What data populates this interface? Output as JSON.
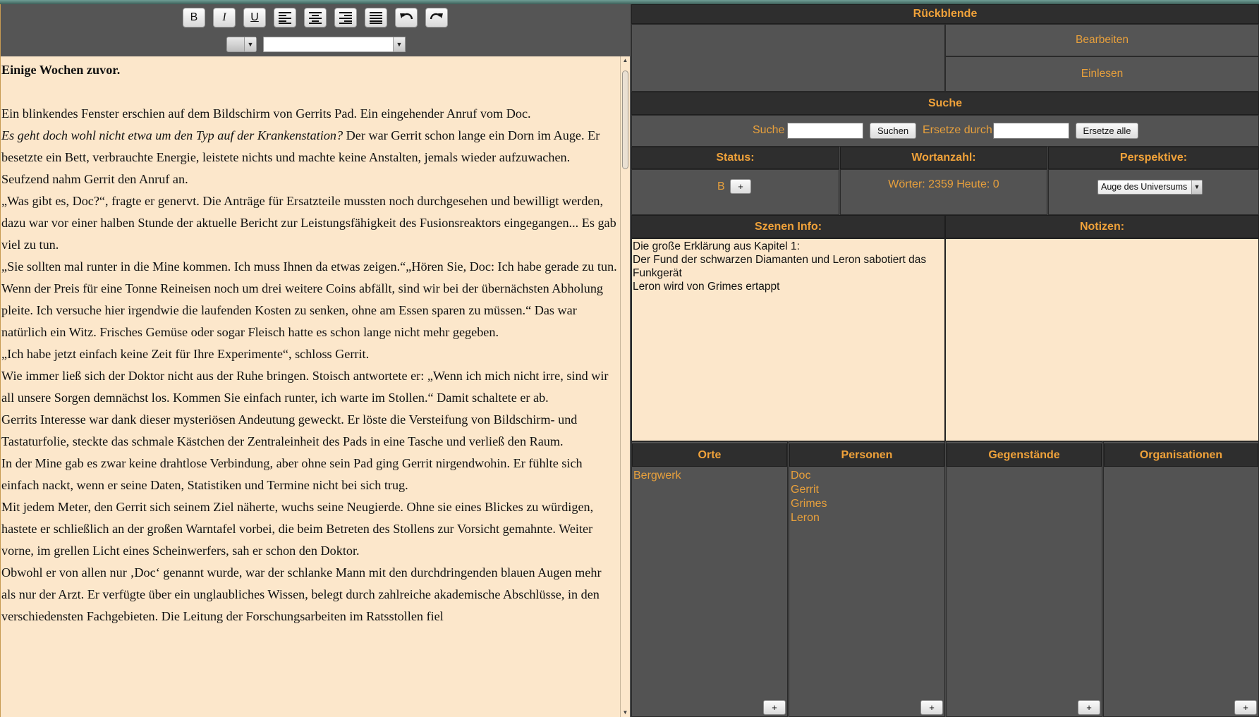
{
  "toolbar": {
    "buttons": [
      {
        "name": "bold-button",
        "label": "B",
        "icon": "bold-icon"
      },
      {
        "name": "italic-button",
        "label": "I",
        "icon": "italic-icon"
      },
      {
        "name": "underline-button",
        "label": "U",
        "icon": "underline-icon"
      },
      {
        "name": "align-left-button",
        "label": "",
        "icon": "align-left-icon"
      },
      {
        "name": "align-center-button",
        "label": "",
        "icon": "align-center-icon"
      },
      {
        "name": "align-right-button",
        "label": "",
        "icon": "align-right-icon"
      },
      {
        "name": "justify-button",
        "label": "",
        "icon": "justify-icon"
      },
      {
        "name": "undo-button",
        "label": "",
        "icon": "undo-icon"
      },
      {
        "name": "redo-button",
        "label": "",
        "icon": "redo-icon"
      }
    ],
    "font_size_value": "",
    "font_family_value": ""
  },
  "document": {
    "title": "Einige Wochen zuvor.",
    "p1": "Ein blinkendes Fenster erschien auf dem Bildschirm von Gerrits Pad. Ein eingehender Anruf vom Doc.",
    "p2_italic": "Es geht doch wohl nicht etwa um den Typ auf der Krankenstation?",
    "p2_rest": " Der war Gerrit schon lange ein Dorn im Auge. Er besetzte ein Bett, verbrauchte Energie, leistete nichts und machte keine Anstalten, jemals wieder aufzuwachen.",
    "p3": "Seufzend nahm Gerrit den Anruf an.",
    "p4": "„Was gibt es, Doc?“, fragte er genervt. Die Anträge für Ersatzteile mussten noch durchgesehen und bewilligt werden, dazu war vor einer halben Stunde der aktuelle Bericht zur Leistungsfähigkeit des Fusionsreaktors eingegangen... Es gab viel zu tun.",
    "p5": "„Sie sollten mal runter in die Mine kommen. Ich muss Ihnen da etwas zeigen.“„Hören Sie, Doc: Ich habe gerade zu tun. Wenn der Preis für eine Tonne Reineisen noch um drei weitere Coins abfällt, sind wir bei der übernächsten Abholung pleite. Ich versuche hier irgendwie die laufenden Kosten zu senken, ohne am Essen sparen zu müssen.“ Das war natürlich ein Witz. Frisches Gemüse oder sogar Fleisch hatte es schon lange nicht mehr gegeben.",
    "p6": "„Ich habe jetzt einfach keine Zeit für Ihre Experimente“, schloss Gerrit.",
    "p7": "Wie immer ließ sich der Doktor nicht aus der Ruhe bringen. Stoisch antwortete er: „Wenn ich mich nicht irre, sind wir all unsere Sorgen demnächst los. Kommen Sie einfach runter, ich warte im Stollen.“ Damit schaltete er ab.",
    "p8": "Gerrits Interesse war dank dieser mysteriösen Andeutung geweckt. Er löste die Versteifung von Bildschirm- und Tastaturfolie, steckte das schmale Kästchen der Zentraleinheit des Pads in eine Tasche und verließ den Raum.",
    "p9": "In der Mine gab es zwar keine drahtlose Verbindung, aber ohne sein Pad ging Gerrit nirgendwohin. Er fühlte sich einfach nackt, wenn er seine Daten, Statistiken und Termine nicht bei sich trug.",
    "p10": "Mit jedem Meter, den Gerrit sich seinem Ziel näherte, wuchs seine Neugierde. Ohne sie eines Blickes zu würdigen, hastete er schließlich an der großen Warntafel vorbei, die beim Betreten des Stollens zur Vorsicht gemahnte. Weiter vorne, im grellen Licht eines Scheinwerfers, sah er schon den Doktor.",
    "p11": "Obwohl er von allen nur ‚Doc‘ genannt wurde, war der schlanke Mann mit den durchdringenden blauen Augen mehr als nur der Arzt. Er verfügte über ein unglaubliches Wissen, belegt durch zahlreiche akademische Abschlüsse, in den verschiedensten Fachgebieten. Die Leitung der Forschungsarbeiten im Ratsstollen fiel"
  },
  "rueckblende": {
    "title": "Rückblende",
    "edit_label": "Bearbeiten",
    "read_label": "Einlesen"
  },
  "search": {
    "title": "Suche",
    "search_label": "Suche",
    "search_value": "",
    "search_button": "Suchen",
    "replace_label": "Ersetze durch",
    "replace_value": "",
    "replace_all_button": "Ersetze alle"
  },
  "status": {
    "title": "Status:",
    "value": "B",
    "add_label": "+"
  },
  "wordcount": {
    "title": "Wortanzahl:",
    "text": "Wörter: 2359 Heute: 0"
  },
  "perspective": {
    "title": "Perspektive:",
    "selected": "Auge des Universums"
  },
  "scene_info": {
    "title": "Szenen Info:",
    "lines": [
      "Die große Erklärung aus Kapitel 1:",
      "Der Fund der schwarzen Diamanten und Leron sabotiert das Funkgerät",
      "Leron wird von Grimes ertappt"
    ]
  },
  "notes": {
    "title": "Notizen:",
    "value": ""
  },
  "entities": {
    "places": {
      "title": "Orte",
      "items": [
        "Bergwerk"
      ],
      "add_label": "+"
    },
    "persons": {
      "title": "Personen",
      "items": [
        "Doc",
        "Gerrit",
        "Grimes",
        "Leron"
      ],
      "add_label": "+"
    },
    "objects": {
      "title": "Gegenstände",
      "items": [],
      "add_label": "+"
    },
    "organisations": {
      "title": "Organisationen",
      "items": [],
      "add_label": "+"
    }
  }
}
